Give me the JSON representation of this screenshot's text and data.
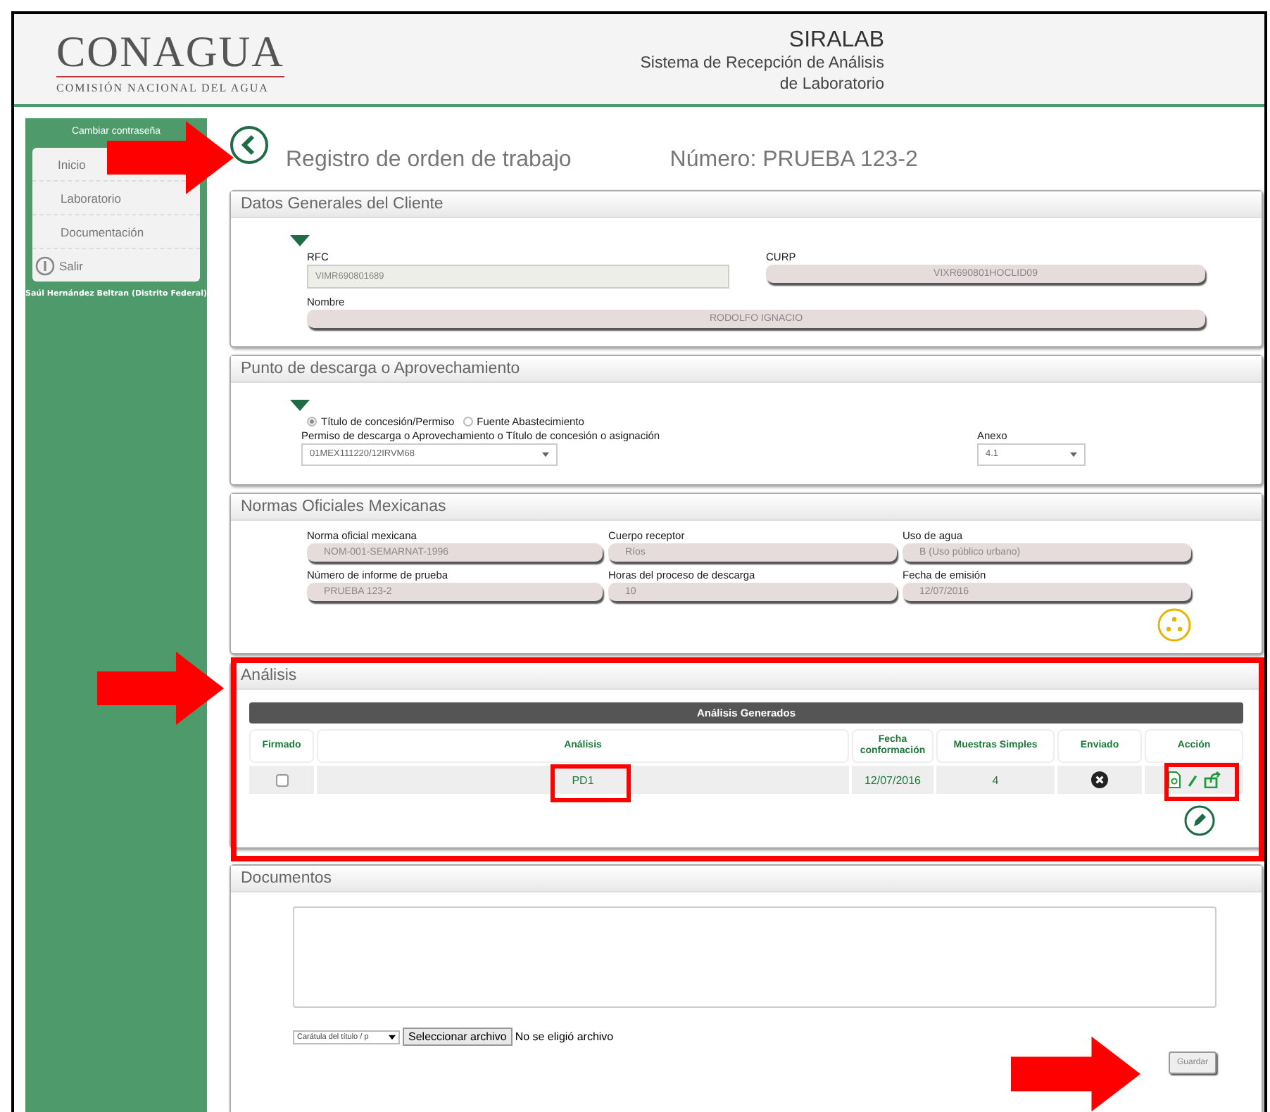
{
  "header": {
    "logo": "CONAGUA",
    "logo_subtitle": "COMISIÓN NACIONAL DEL AGUA",
    "app_name": "SIRALAB",
    "app_subtitle_1": "Sistema de Recepción de Análisis",
    "app_subtitle_2": "de Laboratorio"
  },
  "sidebar": {
    "change_password": "Cambiar contraseña",
    "items": [
      {
        "label": "Inicio",
        "kind": "link"
      },
      {
        "label": "Laboratorio",
        "kind": "link"
      },
      {
        "label": "Documentación",
        "kind": "link"
      },
      {
        "label": "Salir",
        "kind": "exit"
      }
    ],
    "user": "Saúl Hernández Beltran (Distrito Federal)"
  },
  "page": {
    "title": "Registro de orden de trabajo",
    "number": "Número: PRUEBA 123-2"
  },
  "client": {
    "title": "Datos Generales del Cliente",
    "fields": [
      {
        "label": "RFC",
        "value": "VIMR690801689",
        "kind": "input"
      },
      {
        "label": "CURP",
        "value": "VIXR690801HOCLID09",
        "kind": "pill"
      },
      {
        "label": "Nombre",
        "value": "RODOLFO IGNACIO",
        "kind": "pill"
      }
    ]
  },
  "discharge": {
    "title": "Punto de descarga o Aprovechamiento",
    "radios": [
      {
        "label": "Título de concesión/Permiso",
        "selected": true
      },
      {
        "label": "Fuente Abastecimiento",
        "selected": false
      }
    ],
    "permit_label": "Permiso de descarga o Aprovechamiento o Título de concesión o asignación",
    "permit_value": "01MEX111220/12IRVM68",
    "annex_label": "Anexo",
    "annex_value": "4.1"
  },
  "norms": {
    "title": "Normas Oficiales Mexicanas",
    "fields": [
      {
        "label": "Norma oficial mexicana",
        "value": "NOM-001-SEMARNAT-1996"
      },
      {
        "label": "Cuerpo receptor",
        "value": "Ríos"
      },
      {
        "label": "Uso de agua",
        "value": "B (Uso público urbano)"
      },
      {
        "label": "Número de informe de prueba",
        "value": "PRUEBA 123-2"
      },
      {
        "label": "Horas del proceso de descarga",
        "value": "10"
      },
      {
        "label": "Fecha de emisión",
        "value": "12/07/2016"
      }
    ]
  },
  "analysis": {
    "title": "Análisis",
    "table_title": "Análisis Generados",
    "columns": [
      "Firmado",
      "Análisis",
      "Fecha conformación",
      "Muestras Simples",
      "Enviado",
      "Acción"
    ],
    "rows": [
      {
        "checked": false,
        "analysis": "PD1",
        "date": "12/07/2016",
        "samples": "4",
        "sent": false
      }
    ]
  },
  "documents": {
    "title": "Documentos",
    "doc_type": "Carátula del título / p",
    "file_button": "Seleccionar archivo",
    "file_status": "No se eligió archivo",
    "save": "Guardar"
  }
}
